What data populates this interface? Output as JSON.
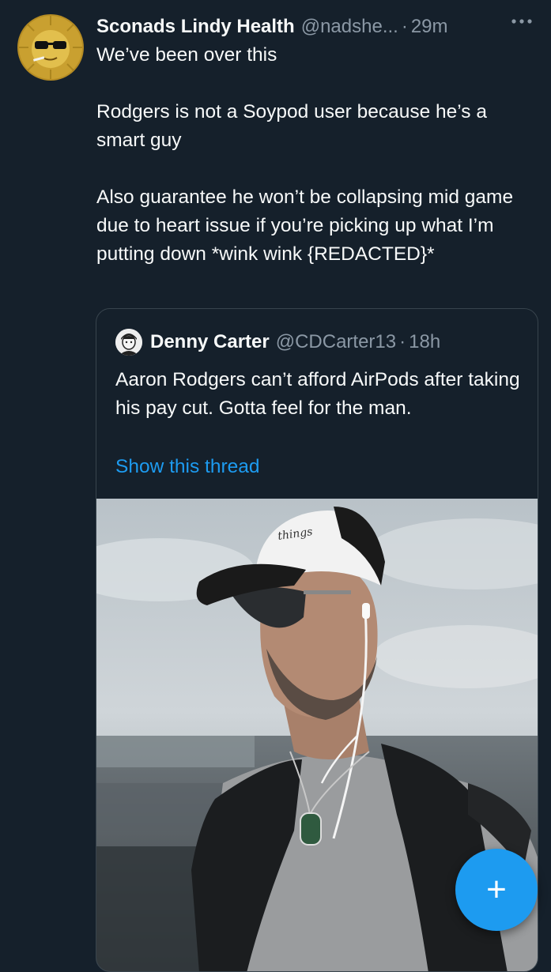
{
  "tweet": {
    "display_name": "Sconads Lindy Health",
    "handle": "@nadshe...",
    "separator": "·",
    "time": "29m",
    "more_icon": "more-horizontal-icon",
    "lines": [
      "We’ve been over this",
      "",
      "Rodgers is not a Soypod user because he’s a smart guy",
      "",
      "Also guarantee he won’t be collapsing mid game due to heart issue if you’re picking up what I’m putting down *wink wink {REDACTED}*"
    ]
  },
  "quoted_tweet": {
    "display_name": "Denny Carter",
    "handle": "@CDCarter13",
    "separator": "·",
    "time": "18h",
    "text": "Aaron Rodgers can’t afford AirPods after taking his pay cut. Gotta feel for the man.",
    "show_thread": "Show this thread",
    "cap_text": "things"
  },
  "compose_button": {
    "icon": "plus-icon",
    "glyph": "+"
  },
  "colors": {
    "background": "#15202b",
    "text": "#f7f9f9",
    "muted": "#8b98a5",
    "accent": "#1d9bf0",
    "border": "#38444d"
  }
}
